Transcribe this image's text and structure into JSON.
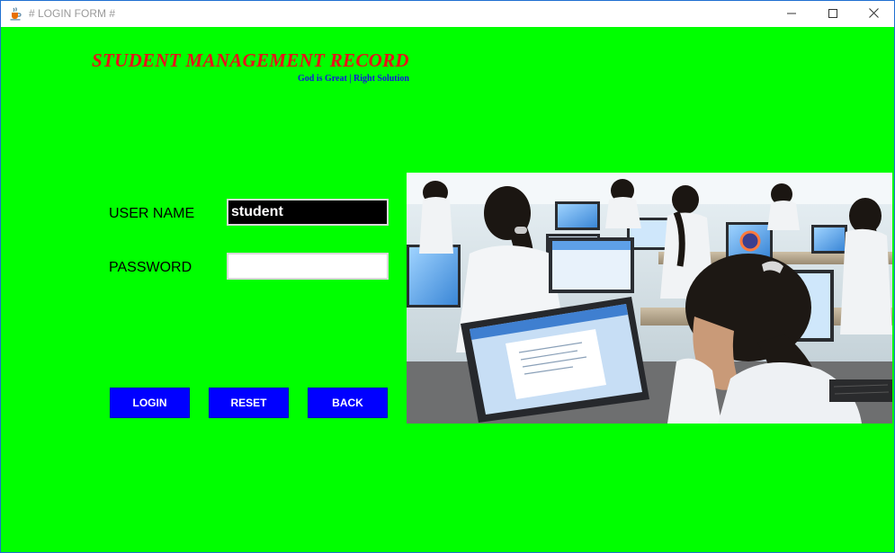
{
  "window": {
    "title": "# LOGIN FORM #",
    "icon": "java-cup-icon",
    "controls": [
      "minimize-icon",
      "maximize-icon",
      "close-icon"
    ]
  },
  "header": {
    "title": "STUDENT MANAGEMENT RECORD",
    "subtitle": "God is Great | Right Solution"
  },
  "form": {
    "username_label": "USER NAME",
    "username_value": "student",
    "password_label": "PASSWORD",
    "password_value": ""
  },
  "buttons": {
    "login": "LOGIN",
    "reset": "RESET",
    "back": "BACK"
  },
  "image": {
    "subject": "computer-lab-students-photo"
  },
  "colors": {
    "background": "#00ff00",
    "title": "#e8101a",
    "subtitle": "#1414e0",
    "button": "#0000ff",
    "username_field_bg": "#000000"
  }
}
